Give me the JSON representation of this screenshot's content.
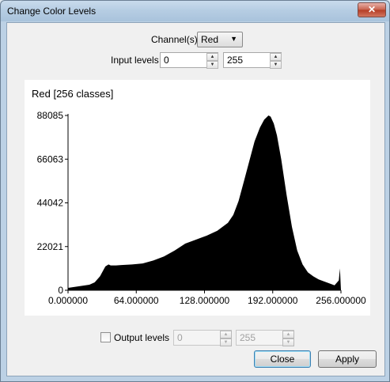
{
  "window": {
    "title": "Change Color Levels",
    "close_glyph": "✕"
  },
  "channel": {
    "label": "Channel(s)",
    "selected": "Red",
    "arrow": "▼"
  },
  "input_levels": {
    "label": "Input levels",
    "low": "0",
    "high": "255"
  },
  "spin_glyphs": {
    "up": "▲",
    "down": "▼"
  },
  "output_levels": {
    "label": "Output levels",
    "checked": false,
    "low": "0",
    "high": "255"
  },
  "buttons": {
    "close": "Close",
    "apply": "Apply"
  },
  "chart_data": {
    "type": "area",
    "title": "Red [256 classes]",
    "xlim": [
      0,
      256
    ],
    "ylim": [
      0,
      88085
    ],
    "xticks": [
      "0.000000",
      "64.000000",
      "128.000000",
      "192.000000",
      "256.000000"
    ],
    "yticks": [
      "88085",
      "66063",
      "44042",
      "22021",
      "0"
    ],
    "series": [
      {
        "x": [
          0,
          10,
          20,
          25,
          30,
          35,
          38,
          40,
          45,
          50,
          60,
          70,
          80,
          90,
          100,
          110,
          120,
          130,
          140,
          150,
          155,
          160,
          165,
          170,
          175,
          180,
          184,
          188,
          190,
          193,
          196,
          200,
          205,
          210,
          215,
          220,
          225,
          230,
          235,
          240,
          245,
          250,
          254,
          255,
          256
        ],
        "y": [
          1200,
          2000,
          2800,
          4000,
          7000,
          12000,
          13000,
          12500,
          12500,
          12700,
          13000,
          13500,
          15000,
          17000,
          20000,
          23500,
          25500,
          27500,
          30000,
          34000,
          38000,
          45000,
          55000,
          65000,
          75000,
          82000,
          86000,
          88085,
          87500,
          84000,
          78000,
          66000,
          48000,
          32000,
          20000,
          13000,
          9000,
          7000,
          5500,
          4500,
          3500,
          2500,
          5000,
          11000,
          0
        ]
      }
    ]
  }
}
